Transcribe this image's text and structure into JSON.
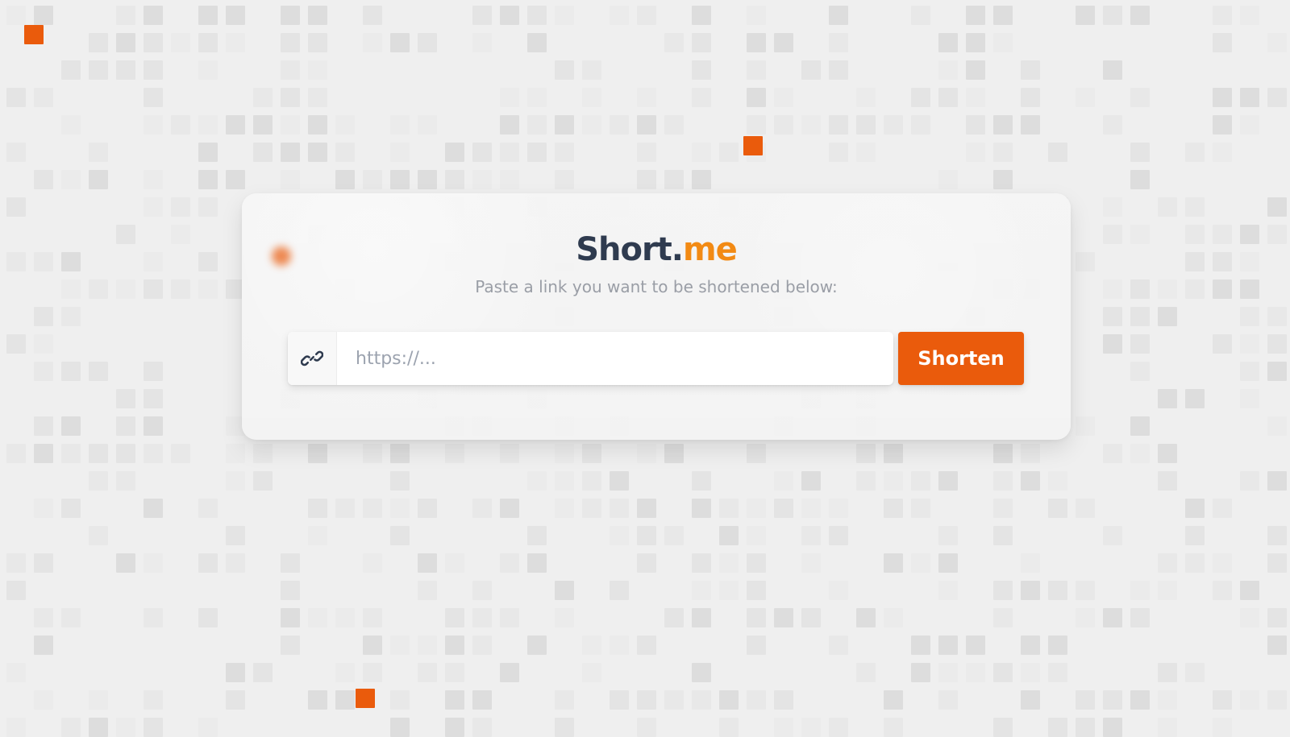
{
  "background": {
    "base_color": "#efefef",
    "tile_colors": [
      "#e4e4e4",
      "#e8e8e8",
      "#ebebeb",
      "#dddddd"
    ],
    "accent_color": "#ea5b0c"
  },
  "brand": {
    "title_primary": "Short.",
    "title_accent": "me",
    "accent_color": "#f28a14"
  },
  "hero": {
    "subtitle": "Paste a link you want to be shortened below:"
  },
  "form": {
    "icon": "link-icon",
    "input_placeholder": "https://...",
    "input_value": "",
    "button_label": "Shorten",
    "button_color": "#ea5b0c"
  }
}
